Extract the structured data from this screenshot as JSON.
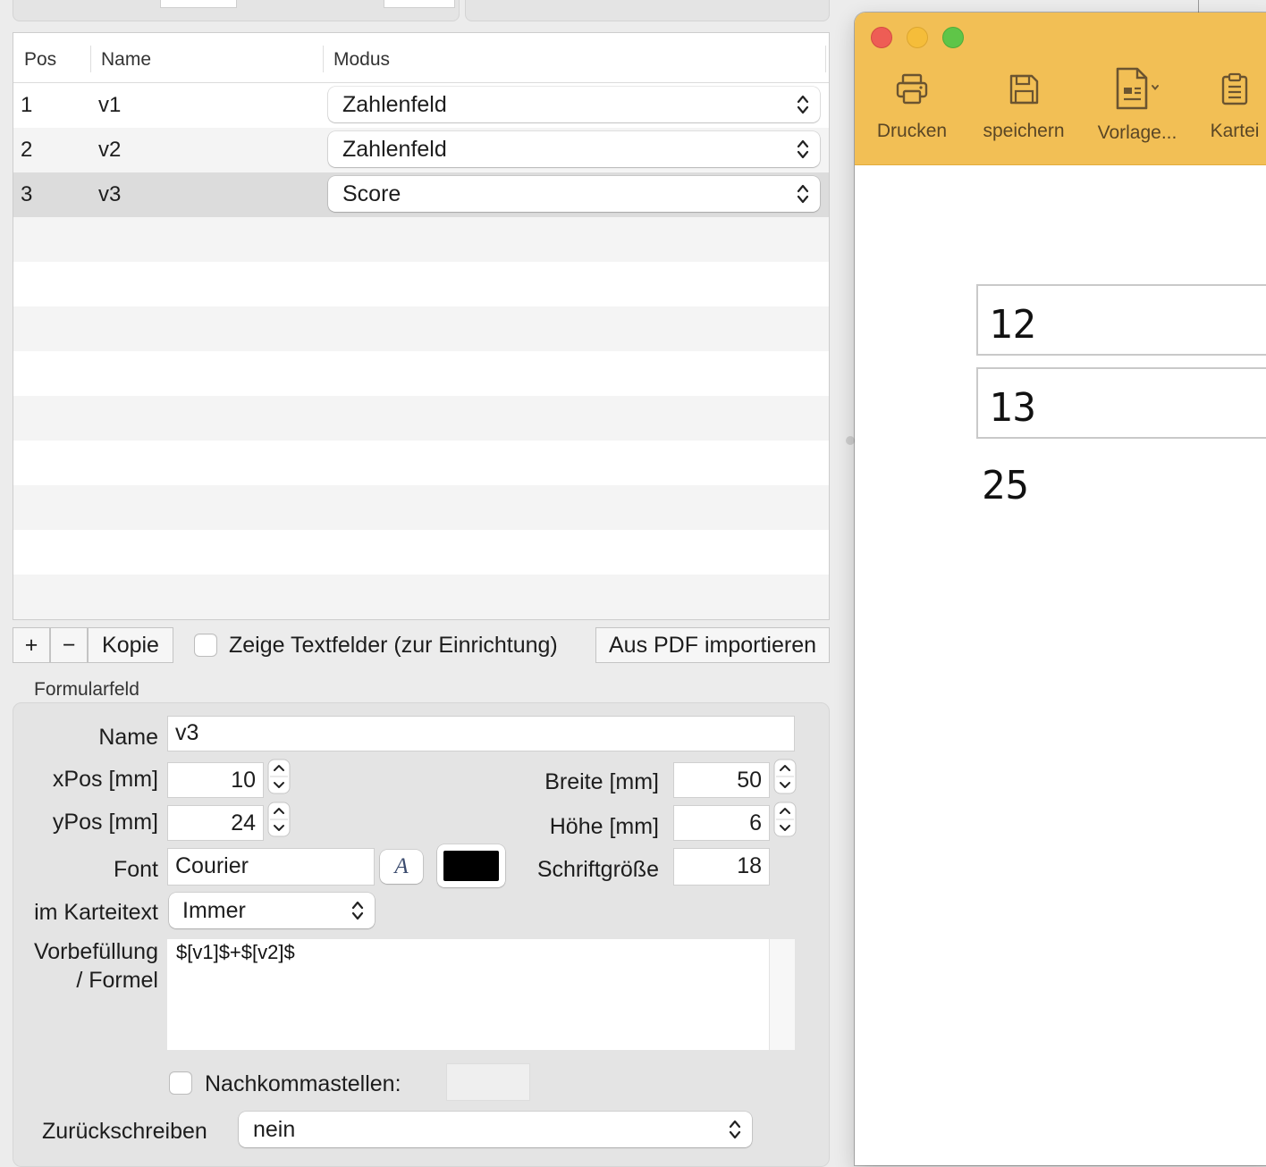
{
  "table": {
    "columns": [
      "Pos",
      "Name",
      "Modus"
    ],
    "rows": [
      {
        "pos": "1",
        "name": "v1",
        "modus": "Zahlenfeld"
      },
      {
        "pos": "2",
        "name": "v2",
        "modus": "Zahlenfeld"
      },
      {
        "pos": "3",
        "name": "v3",
        "modus": "Score"
      }
    ]
  },
  "buttons": {
    "add": "+",
    "remove": "−",
    "copy": "Kopie",
    "show_textfields": "Zeige Textfelder (zur Einrichtung)",
    "import_pdf": "Aus PDF importieren"
  },
  "formfield": {
    "section_title": "Formularfeld",
    "name_label": "Name",
    "name_value": "v3",
    "xpos_label": "xPos [mm]",
    "xpos_value": "10",
    "ypos_label": "yPos [mm]",
    "ypos_value": "24",
    "width_label": "Breite [mm]",
    "width_value": "50",
    "height_label": "Höhe [mm]",
    "height_value": "6",
    "font_label": "Font",
    "font_value": "Courier",
    "font_button": "A",
    "color_value": "#000000",
    "fontsize_label": "Schriftgröße",
    "fontsize_value": "18",
    "karteitext_label": "im Karteitext",
    "karteitext_value": "Immer",
    "formula_label_1": "Vorbefüllung",
    "formula_label_2": "/ Formel",
    "formula_value": "$[v1]$+$[v2]$",
    "decimals_label": "Nachkommastellen:",
    "decimals_value": "",
    "writeback_label": "Zurückschreiben",
    "writeback_value": "nein"
  },
  "window": {
    "toolbar": [
      {
        "label": "Drucken",
        "icon": "printer-icon"
      },
      {
        "label": "speichern",
        "icon": "save-icon"
      },
      {
        "label": "Vorlage...",
        "icon": "template-icon"
      },
      {
        "label": "Kartei",
        "icon": "clipboard-icon"
      }
    ],
    "fields": [
      "12",
      "13"
    ],
    "result": "25",
    "accent": "#f2bf55"
  }
}
